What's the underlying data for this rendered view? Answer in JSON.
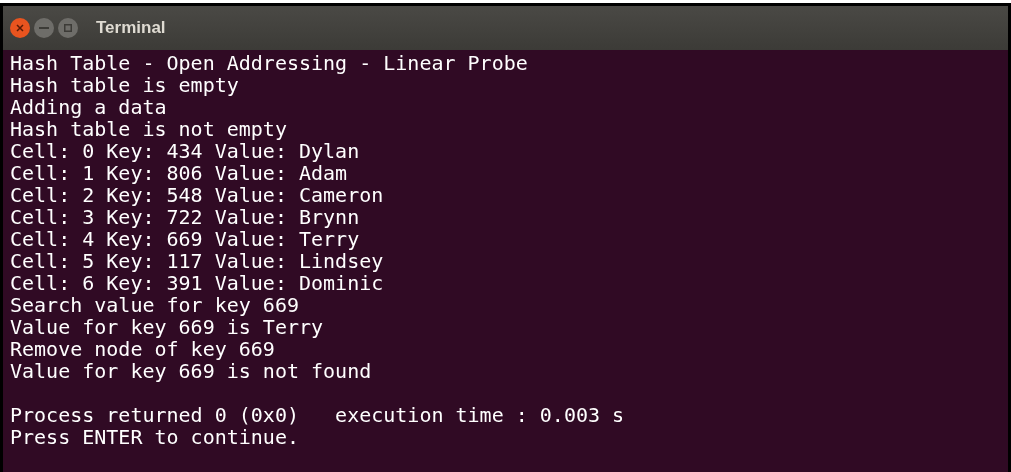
{
  "window": {
    "title": "Terminal"
  },
  "output_lines": [
    "Hash Table - Open Addressing - Linear Probe",
    "Hash table is empty",
    "Adding a data",
    "Hash table is not empty",
    "Cell: 0 Key: 434 Value: Dylan",
    "Cell: 1 Key: 806 Value: Adam",
    "Cell: 2 Key: 548 Value: Cameron",
    "Cell: 3 Key: 722 Value: Brynn",
    "Cell: 4 Key: 669 Value: Terry",
    "Cell: 5 Key: 117 Value: Lindsey",
    "Cell: 6 Key: 391 Value: Dominic",
    "Search value for key 669",
    "Value for key 669 is Terry",
    "Remove node of key 669",
    "Value for key 669 is not found"
  ],
  "footer_lines": [
    "Process returned 0 (0x0)   execution time : 0.003 s",
    "Press ENTER to continue."
  ]
}
